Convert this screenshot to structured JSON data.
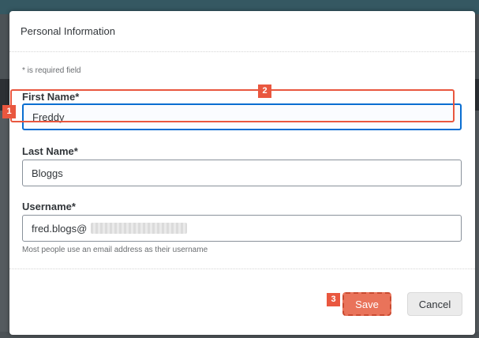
{
  "dialog": {
    "title": "Personal Information",
    "required_note": "* is required field",
    "fields": {
      "first_name": {
        "label": "First Name*",
        "value": "Freddy"
      },
      "last_name": {
        "label": "Last Name*",
        "value": "Bloggs"
      },
      "username": {
        "label": "Username*",
        "value": "fred.blogs@",
        "hint": "Most people use an email address as their username"
      }
    },
    "buttons": {
      "save": "Save",
      "cancel": "Cancel"
    }
  },
  "annotations": {
    "step1": "1",
    "step2": "2",
    "step3": "3"
  },
  "colors": {
    "accent": "#e9573f",
    "focus": "#0a6ed1",
    "save_bg": "#e9735a"
  }
}
